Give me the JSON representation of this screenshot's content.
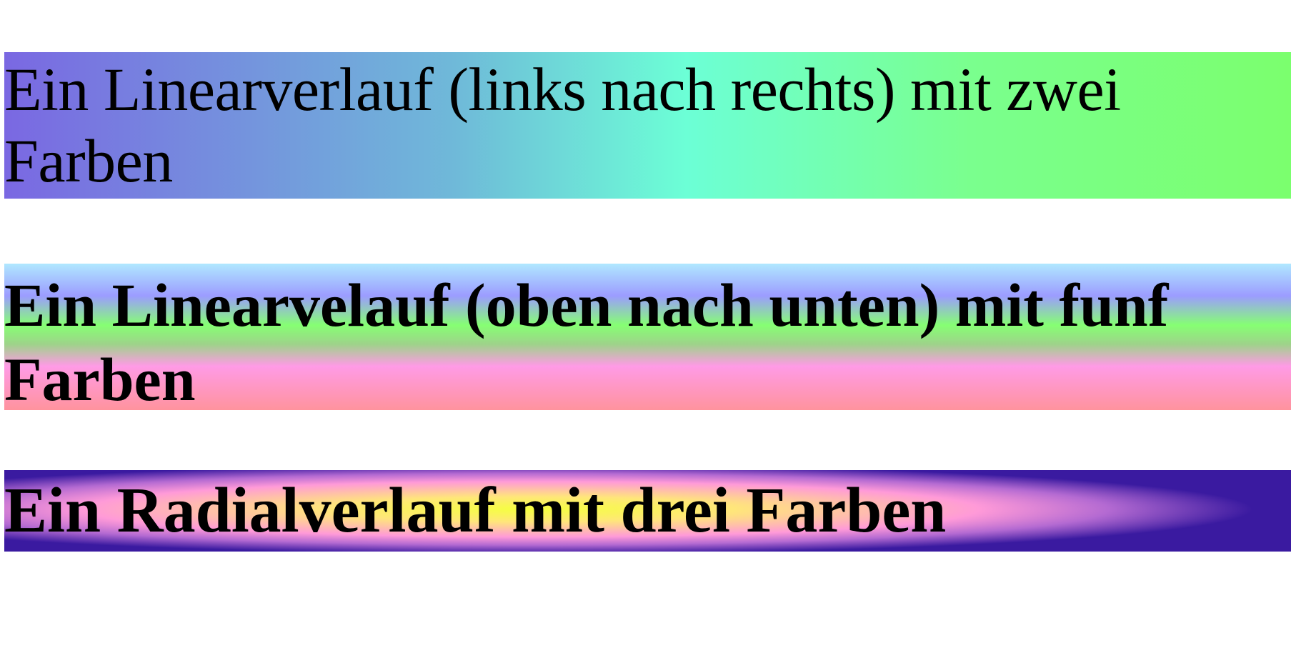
{
  "banners": [
    {
      "text": "Ein Linearverlauf (links nach rechts) mit zwei Farben",
      "gradient": "linear, left-to-right",
      "colors": [
        "#7a68e2",
        "#7bff6e"
      ]
    },
    {
      "text": "Ein Linearvelauf (oben nach unten) mit funf Farben",
      "gradient": "linear, top-to-bottom",
      "colors": [
        "#9c9cff",
        "#86ff73",
        "#ff9be6",
        "#ff939d",
        "#b0e8ff"
      ]
    },
    {
      "text": "Ein Radialverlauf mit drei Farben",
      "gradient": "radial",
      "colors": [
        "#f5ff40",
        "#ff9ad8",
        "#3a1aa0"
      ]
    }
  ]
}
